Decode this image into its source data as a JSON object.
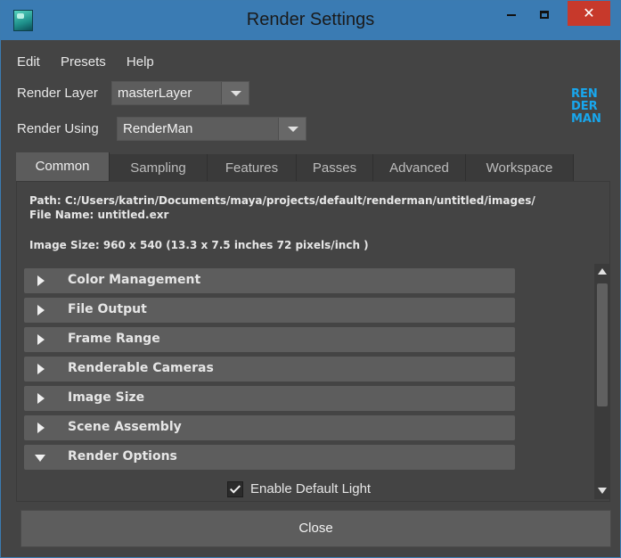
{
  "window": {
    "title": "Render Settings",
    "close_glyph": "✕"
  },
  "menu": [
    "Edit",
    "Presets",
    "Help"
  ],
  "render_layer": {
    "label": "Render Layer",
    "value": "masterLayer"
  },
  "render_using": {
    "label": "Render Using",
    "value": "RenderMan"
  },
  "logo": {
    "lines": [
      "REN",
      "DER",
      "MAN"
    ],
    "color": "#18a7ee"
  },
  "tabs": [
    "Common",
    "Sampling",
    "Features",
    "Passes",
    "Advanced",
    "Workspace"
  ],
  "active_tab": "Common",
  "info": {
    "path": "Path: C:/Users/katrin/Documents/maya/projects/default/renderman/untitled/images/",
    "file_name": "File Name:  untitled.exr",
    "image_size": "Image Size: 960 x 540 (13.3 x 7.5 inches 72 pixels/inch )"
  },
  "sections": [
    {
      "label": "Color Management",
      "expanded": false
    },
    {
      "label": "File Output",
      "expanded": false
    },
    {
      "label": "Frame Range",
      "expanded": false
    },
    {
      "label": "Renderable Cameras",
      "expanded": false
    },
    {
      "label": "Image Size",
      "expanded": false
    },
    {
      "label": "Scene Assembly",
      "expanded": false
    },
    {
      "label": "Render Options",
      "expanded": true
    }
  ],
  "enable_default_light": {
    "label": "Enable Default Light",
    "checked": true
  },
  "close_button": "Close",
  "colors": {
    "title_bar": "#3a7bb3",
    "close_red": "#c7392b",
    "panel": "#444444"
  }
}
